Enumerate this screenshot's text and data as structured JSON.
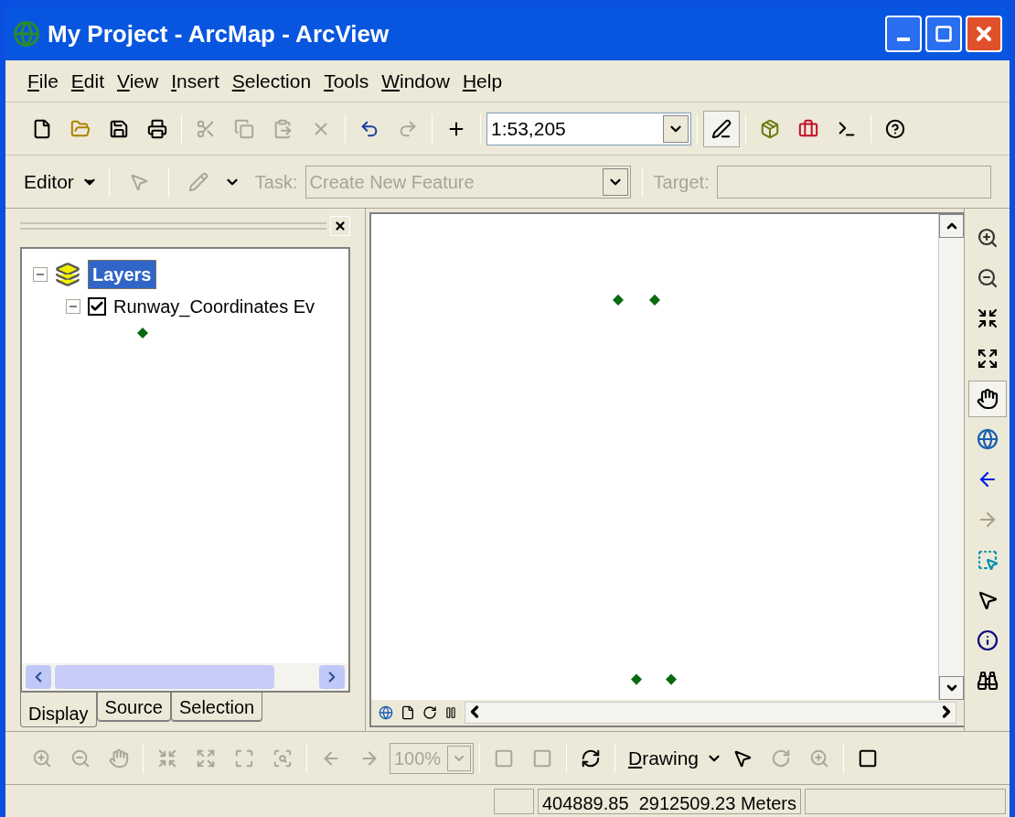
{
  "window": {
    "title": "My Project - ArcMap - ArcView"
  },
  "menu": [
    "File",
    "Edit",
    "View",
    "Insert",
    "Selection",
    "Tools",
    "Window",
    "Help"
  ],
  "standard_toolbar": {
    "buttons": [
      {
        "disabled": false
      },
      {
        "disabled": false
      },
      {
        "disabled": false
      },
      {
        "disabled": false
      },
      {
        "disabled": true
      },
      {
        "disabled": true
      },
      {
        "disabled": true
      },
      {
        "disabled": true
      },
      {
        "disabled": false
      },
      {
        "disabled": true
      },
      {
        "disabled": false
      }
    ],
    "scale": "1:53,205",
    "tools": [
      {
        "selected": true
      },
      {
        "selected": false
      },
      {
        "selected": false
      },
      {
        "selected": false
      },
      {
        "selected": false
      }
    ]
  },
  "editor_toolbar": {
    "editor_menu": "Editor",
    "task_label": "Task:",
    "task_value": "Create New Feature",
    "target_label": "Target:",
    "disabled": true
  },
  "toc": {
    "root": {
      "label": "Layers",
      "selected": true,
      "expanded": true,
      "children": [
        {
          "label": "Runway_Coordinates Ev",
          "checked": true,
          "expanded": true
        }
      ]
    },
    "tabs": [
      {
        "label": "Display",
        "selected": true
      },
      {
        "label": "Source",
        "selected": false
      },
      {
        "label": "Selection",
        "selected": false
      }
    ]
  },
  "tools_toolbar": [
    {
      "selected": false
    },
    {
      "selected": false
    },
    {
      "selected": false
    },
    {
      "selected": false
    },
    {
      "selected": true
    },
    {
      "selected": false
    },
    {
      "selected": false
    },
    {
      "selected": false
    },
    {
      "selected": false
    },
    {
      "selected": false
    },
    {
      "selected": false
    },
    {
      "selected": false
    }
  ],
  "layout_toolbar": {
    "zoom": "100%",
    "drawing_menu": "Drawing"
  },
  "status_bar": {
    "coordinates": "404889.85  2912509.23 Meters"
  }
}
